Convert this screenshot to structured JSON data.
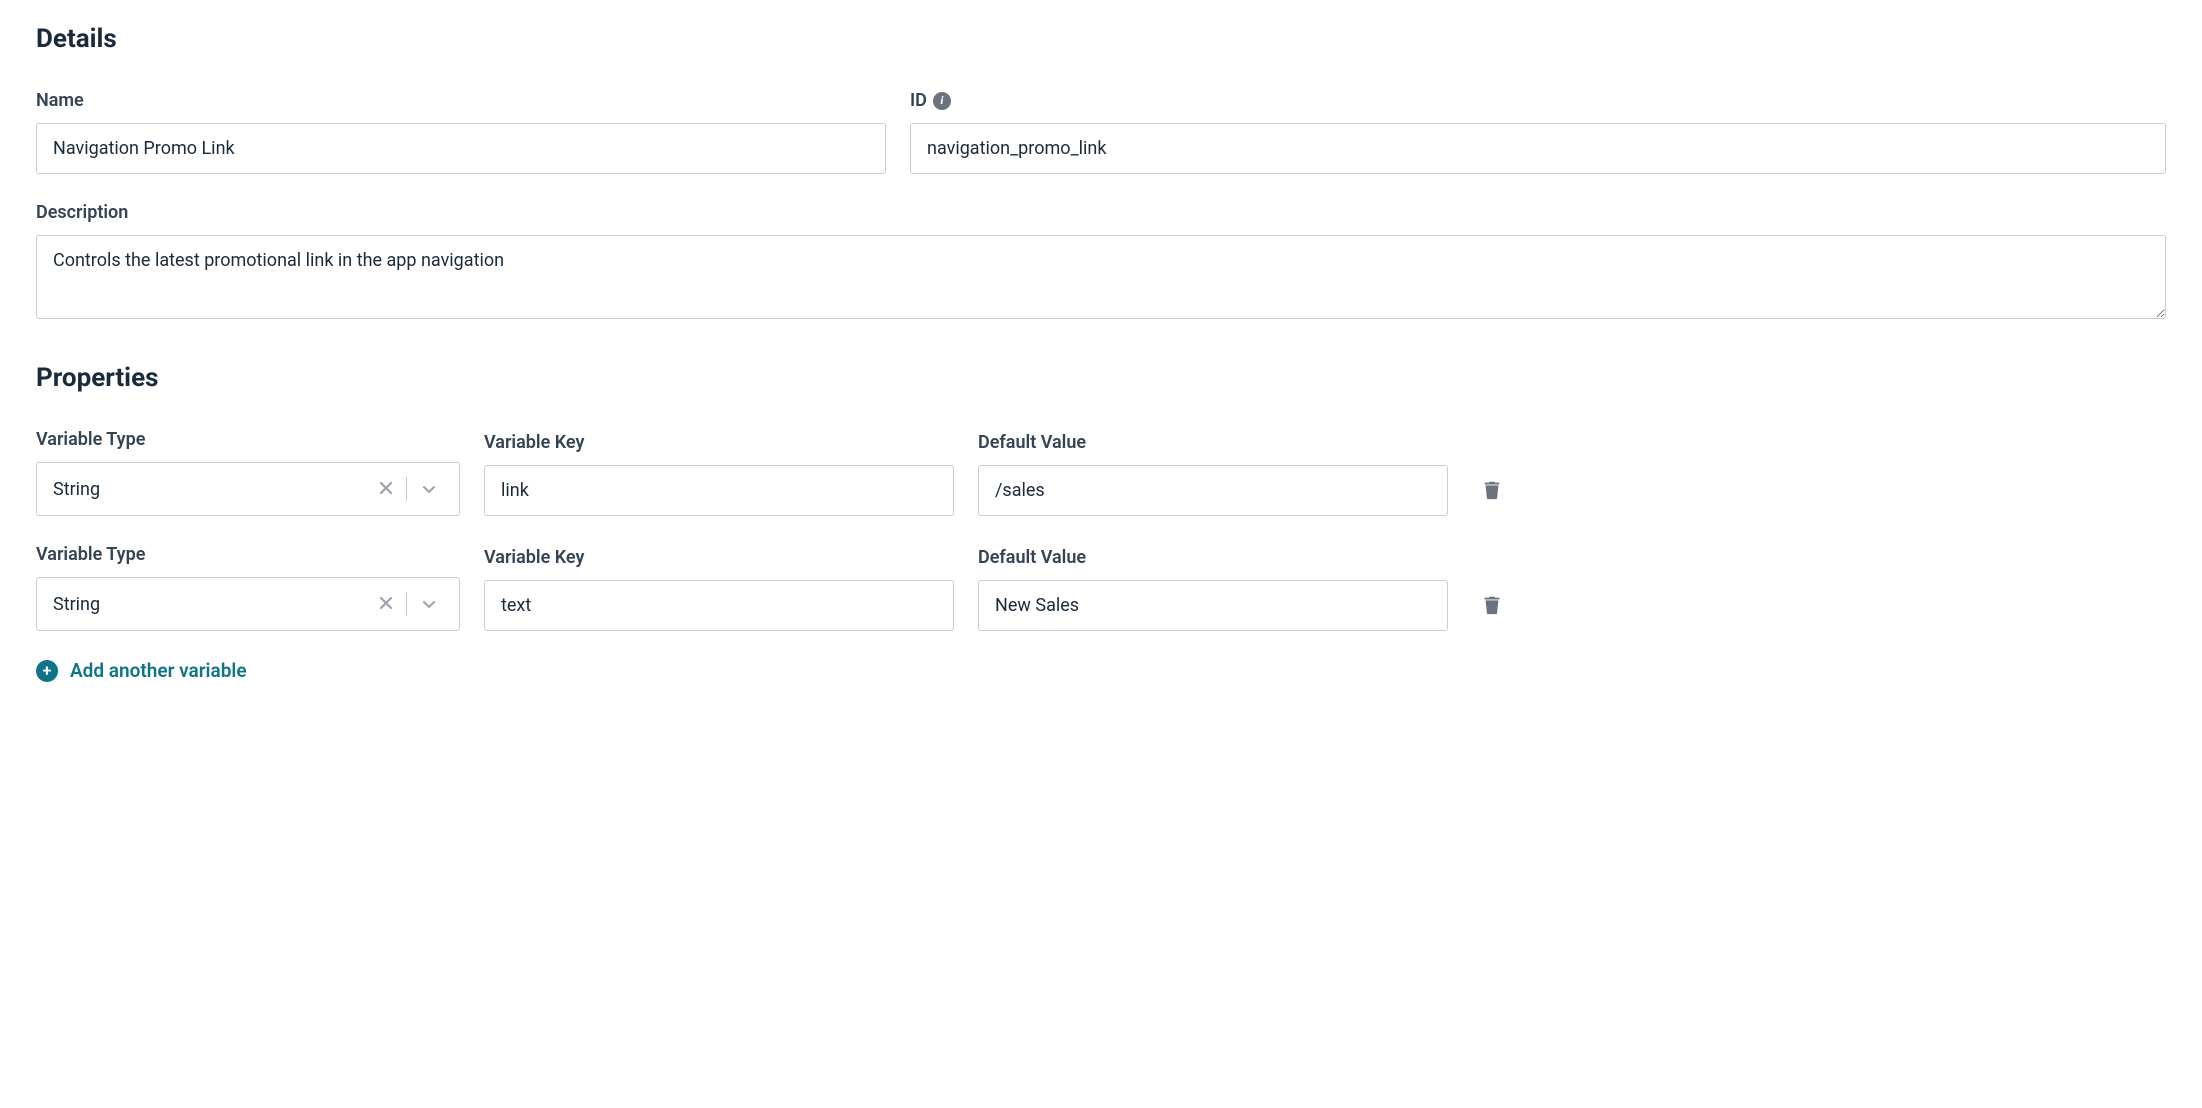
{
  "sections": {
    "details": {
      "heading": "Details",
      "name_label": "Name",
      "name_value": "Navigation Promo Link",
      "id_label": "ID",
      "id_value": "navigation_promo_link",
      "description_label": "Description",
      "description_value": "Controls the latest promotional link in the app navigation"
    },
    "properties": {
      "heading": "Properties",
      "column_labels": {
        "type": "Variable Type",
        "key": "Variable Key",
        "default": "Default Value"
      },
      "rows": [
        {
          "type": "String",
          "key": "link",
          "default": "/sales"
        },
        {
          "type": "String",
          "key": "text",
          "default": "New Sales"
        }
      ],
      "add_variable_label": "Add another variable"
    }
  }
}
